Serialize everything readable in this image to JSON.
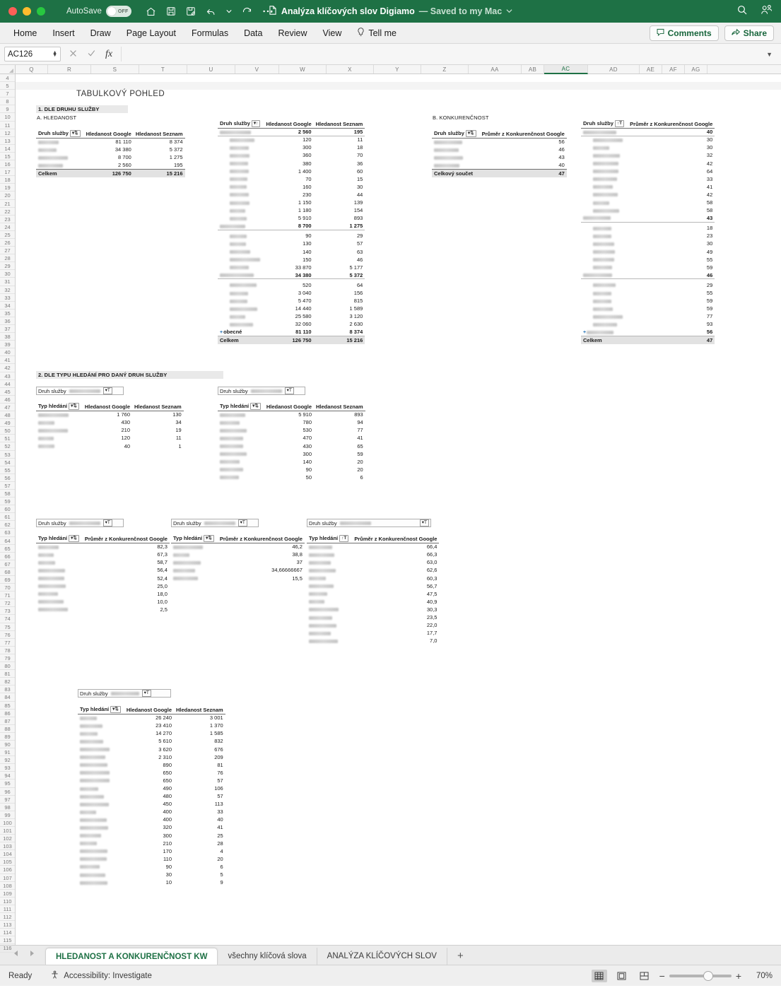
{
  "titlebar": {
    "autosave_label": "AutoSave",
    "autosave_state": "OFF",
    "document_title": "Analýza klíčových slov Digiamo",
    "saved_status": "— Saved to my Mac",
    "icons": [
      "home-icon",
      "save-icon",
      "save-as-icon",
      "undo-icon",
      "redo-icon",
      "more-icon",
      "search-icon",
      "collaborators-icon"
    ]
  },
  "ribbon": {
    "tabs": [
      {
        "label": "Home"
      },
      {
        "label": "Insert"
      },
      {
        "label": "Draw"
      },
      {
        "label": "Page Layout"
      },
      {
        "label": "Formulas"
      },
      {
        "label": "Data"
      },
      {
        "label": "Review"
      },
      {
        "label": "View"
      },
      {
        "label": "Tell me"
      }
    ],
    "comments_label": "Comments",
    "share_label": "Share"
  },
  "formula_bar": {
    "name_box": "AC126",
    "formula_value": "",
    "cancel_icon": "cancel-icon",
    "confirm_icon": "confirm-icon",
    "function_icon": "fx"
  },
  "grid": {
    "columns": [
      "Q",
      "R",
      "S",
      "T",
      "U",
      "V",
      "W",
      "X",
      "Y",
      "Z",
      "AA",
      "AB",
      "AC",
      "AD",
      "AE",
      "AF",
      "AG"
    ],
    "selected_column": "AC",
    "first_row": 4,
    "last_row": 116,
    "hidden_row_gap_after": 5
  },
  "sheet_content": {
    "page_title": "TABULKOVÝ POHLED",
    "section1_heading": "1. DLE DRUHU SLUŽBY",
    "section1a_heading": "A. HLEDANOST",
    "section1b_heading": "B. KONKURENČNOST",
    "section2_heading": "2. DLE TYPU HLEDÁNÍ PRO DANÝ DRUH SLUŽBY",
    "labels": {
      "druh_sluzby": "Druh služby",
      "typ_hledani": "Typ hledání",
      "hledanost_google": "Hledanost Google",
      "hledanost_seznam": "Hledanost Seznam",
      "prumer_konkurencnost": "Průměr z Konkurenčnost Google",
      "celkem": "Celkem",
      "celkovy_soucet": "Celkový součet",
      "obecne": "obecné"
    },
    "table_A_summary": {
      "headers": [
        "Druh služby",
        "Hledanost Google",
        "Hledanost Seznam"
      ],
      "rows": [
        {
          "label": "",
          "google": "81 110",
          "seznam": "8 374"
        },
        {
          "label": "",
          "google": "34 380",
          "seznam": "5 372"
        },
        {
          "label": "",
          "google": "8 700",
          "seznam": "1 275"
        },
        {
          "label": "",
          "google": "2 560",
          "seznam": "195"
        }
      ],
      "total": {
        "label": "Celkem",
        "google": "126 750",
        "seznam": "15 216"
      }
    },
    "table_A_detail": {
      "headers": [
        "Druh služby",
        "Hledanost Google",
        "Hledanost Seznam"
      ],
      "groups": [
        {
          "header": {
            "label": "",
            "google": "2 560",
            "seznam": "195"
          },
          "rows": [
            {
              "label": "",
              "google": "120",
              "seznam": "11"
            },
            {
              "label": "",
              "google": "300",
              "seznam": "18"
            },
            {
              "label": "",
              "google": "360",
              "seznam": "70"
            },
            {
              "label": "",
              "google": "380",
              "seznam": "36"
            },
            {
              "label": "",
              "google": "1 400",
              "seznam": "60"
            }
          ]
        },
        {
          "header": {
            "label": "",
            "google": "8 700",
            "seznam": "1 275"
          },
          "rows": [
            {
              "label": "",
              "google": "70",
              "seznam": "15"
            },
            {
              "label": "",
              "google": "160",
              "seznam": "30"
            },
            {
              "label": "",
              "google": "230",
              "seznam": "44"
            },
            {
              "label": "",
              "google": "1 150",
              "seznam": "139"
            },
            {
              "label": "",
              "google": "1 180",
              "seznam": "154"
            },
            {
              "label": "",
              "google": "5 910",
              "seznam": "893"
            }
          ]
        },
        {
          "header": {
            "label": "",
            "google": "34 380",
            "seznam": "5 372"
          },
          "rows": [
            {
              "label": "",
              "google": "90",
              "seznam": "29"
            },
            {
              "label": "",
              "google": "130",
              "seznam": "57"
            },
            {
              "label": "",
              "google": "140",
              "seznam": "63"
            },
            {
              "label": "",
              "google": "150",
              "seznam": "46"
            },
            {
              "label": "",
              "google": "33 870",
              "seznam": "5 177"
            }
          ]
        },
        {
          "header": {
            "label": "obecné",
            "google": "81 110",
            "seznam": "8 374",
            "expandable": true
          },
          "rows": [
            {
              "label": "",
              "google": "520",
              "seznam": "64"
            },
            {
              "label": "",
              "google": "3 040",
              "seznam": "156"
            },
            {
              "label": "",
              "google": "5 470",
              "seznam": "815"
            },
            {
              "label": "",
              "google": "14 440",
              "seznam": "1 589"
            },
            {
              "label": "",
              "google": "25 580",
              "seznam": "3 120"
            },
            {
              "label": "",
              "google": "32 060",
              "seznam": "2 630"
            }
          ]
        }
      ],
      "total": {
        "label": "Celkem",
        "google": "126 750",
        "seznam": "15 216"
      }
    },
    "table_B_summary": {
      "headers": [
        "Druh služby",
        "Průměr z Konkurenčnost Google"
      ],
      "rows": [
        {
          "label": "",
          "value": "56"
        },
        {
          "label": "",
          "value": "46"
        },
        {
          "label": "",
          "value": "43"
        },
        {
          "label": "",
          "value": "40"
        }
      ],
      "total": {
        "label": "Celkový součet",
        "value": "47"
      }
    },
    "table_B_detail": {
      "headers": [
        "Druh služby",
        "Průměr z Konkurenčnost Google"
      ],
      "groups": [
        {
          "header": {
            "label": "",
            "value": "40"
          },
          "rows": [
            {
              "label": "",
              "value": "30"
            },
            {
              "label": "",
              "value": "30"
            },
            {
              "label": "",
              "value": "32"
            },
            {
              "label": "",
              "value": "42"
            },
            {
              "label": "",
              "value": "64"
            }
          ]
        },
        {
          "header": {
            "label": "",
            "value": "43"
          },
          "rows": [
            {
              "label": "",
              "value": "33"
            },
            {
              "label": "",
              "value": "41"
            },
            {
              "label": "",
              "value": "42"
            },
            {
              "label": "",
              "value": "58"
            },
            {
              "label": "",
              "value": "58"
            }
          ]
        },
        {
          "header": {
            "label": "",
            "value": "46"
          },
          "rows": [
            {
              "label": "",
              "value": "18"
            },
            {
              "label": "",
              "value": "23"
            },
            {
              "label": "",
              "value": "30"
            },
            {
              "label": "",
              "value": "49"
            },
            {
              "label": "",
              "value": "55"
            },
            {
              "label": "",
              "value": "59"
            }
          ]
        },
        {
          "header": {
            "label": "",
            "value": "56",
            "expandable": true
          },
          "rows": [
            {
              "label": "",
              "value": "29"
            },
            {
              "label": "",
              "value": "55"
            },
            {
              "label": "",
              "value": "59"
            },
            {
              "label": "",
              "value": "59"
            },
            {
              "label": "",
              "value": "77"
            },
            {
              "label": "",
              "value": "93"
            }
          ]
        }
      ],
      "total": {
        "label": "Celkem",
        "value": "47"
      }
    },
    "section2_tables": [
      {
        "slicer_label": "Druh služby",
        "headers": [
          "Typ hledání",
          "Hledanost Google",
          "Hledanost Seznam"
        ],
        "rows": [
          {
            "label": "",
            "google": "1 760",
            "seznam": "130"
          },
          {
            "label": "",
            "google": "430",
            "seznam": "34"
          },
          {
            "label": "",
            "google": "210",
            "seznam": "19"
          },
          {
            "label": "",
            "google": "120",
            "seznam": "11"
          },
          {
            "label": "",
            "google": "40",
            "seznam": "1"
          }
        ]
      },
      {
        "slicer_label": "Druh služby",
        "headers": [
          "Typ hledání",
          "Hledanost Google",
          "Hledanost Seznam"
        ],
        "rows": [
          {
            "label": "",
            "google": "5 910",
            "seznam": "893"
          },
          {
            "label": "",
            "google": "780",
            "seznam": "94"
          },
          {
            "label": "",
            "google": "530",
            "seznam": "77"
          },
          {
            "label": "",
            "google": "470",
            "seznam": "41"
          },
          {
            "label": "",
            "google": "430",
            "seznam": "65"
          },
          {
            "label": "",
            "google": "300",
            "seznam": "59"
          },
          {
            "label": "",
            "google": "140",
            "seznam": "20"
          },
          {
            "label": "",
            "google": "90",
            "seznam": "20"
          },
          {
            "label": "",
            "google": "50",
            "seznam": "6"
          }
        ]
      }
    ],
    "section2_konkurence_tables": [
      {
        "slicer_label": "Druh služby",
        "headers": [
          "Typ hledání",
          "Průměr z Konkurenčnost Google"
        ],
        "rows": [
          {
            "label": "",
            "value": "82,3"
          },
          {
            "label": "",
            "value": "67,3"
          },
          {
            "label": "",
            "value": "58,7"
          },
          {
            "label": "",
            "value": "56,4"
          },
          {
            "label": "",
            "value": "52,4"
          },
          {
            "label": "",
            "value": "25,0"
          },
          {
            "label": "",
            "value": "18,0"
          },
          {
            "label": "",
            "value": "10,0"
          },
          {
            "label": "",
            "value": "2,5"
          }
        ]
      },
      {
        "slicer_label": "Druh služby",
        "headers": [
          "Typ hledání",
          "Průměr z Konkurenčnost Google"
        ],
        "rows": [
          {
            "label": "",
            "value": "46,2"
          },
          {
            "label": "",
            "value": "38,8"
          },
          {
            "label": "",
            "value": "37"
          },
          {
            "label": "",
            "value": "34,66666667"
          },
          {
            "label": "",
            "value": "15,5"
          }
        ]
      },
      {
        "slicer_label": "Druh služby",
        "headers": [
          "Typ hledání",
          "Průměr z Konkurenčnost Google"
        ],
        "rows": [
          {
            "label": "",
            "value": "66,4"
          },
          {
            "label": "",
            "value": "66,3"
          },
          {
            "label": "",
            "value": "63,0"
          },
          {
            "label": "",
            "value": "62,6"
          },
          {
            "label": "",
            "value": "60,3"
          },
          {
            "label": "",
            "value": "56,7"
          },
          {
            "label": "",
            "value": "47,5"
          },
          {
            "label": "",
            "value": "40,9"
          },
          {
            "label": "",
            "value": "30,3"
          },
          {
            "label": "",
            "value": "23,5"
          },
          {
            "label": "",
            "value": "22,0"
          },
          {
            "label": "",
            "value": "17,7"
          },
          {
            "label": "",
            "value": "7,0"
          }
        ]
      }
    ],
    "bottom_table": {
      "slicer_label": "Druh služby",
      "headers": [
        "Typ hledání",
        "Hledanost Google",
        "Hledanost Seznam"
      ],
      "rows": [
        {
          "label": "",
          "google": "26 240",
          "seznam": "3 001"
        },
        {
          "label": "",
          "google": "23 410",
          "seznam": "1 370"
        },
        {
          "label": "",
          "google": "14 270",
          "seznam": "1 585"
        },
        {
          "label": "",
          "google": "5 610",
          "seznam": "832"
        },
        {
          "label": "",
          "google": "3 620",
          "seznam": "676"
        },
        {
          "label": "",
          "google": "2 310",
          "seznam": "209"
        },
        {
          "label": "",
          "google": "890",
          "seznam": "81"
        },
        {
          "label": "",
          "google": "650",
          "seznam": "76"
        },
        {
          "label": "",
          "google": "650",
          "seznam": "57"
        },
        {
          "label": "",
          "google": "490",
          "seznam": "106"
        },
        {
          "label": "",
          "google": "480",
          "seznam": "57"
        },
        {
          "label": "",
          "google": "450",
          "seznam": "113"
        },
        {
          "label": "",
          "google": "400",
          "seznam": "33"
        },
        {
          "label": "",
          "google": "400",
          "seznam": "40"
        },
        {
          "label": "",
          "google": "320",
          "seznam": "41"
        },
        {
          "label": "",
          "google": "300",
          "seznam": "25"
        },
        {
          "label": "",
          "google": "210",
          "seznam": "28"
        },
        {
          "label": "",
          "google": "170",
          "seznam": "4"
        },
        {
          "label": "",
          "google": "110",
          "seznam": "20"
        },
        {
          "label": "",
          "google": "90",
          "seznam": "6"
        },
        {
          "label": "",
          "google": "30",
          "seznam": "5"
        },
        {
          "label": "",
          "google": "10",
          "seznam": "9"
        }
      ]
    }
  },
  "sheet_tabs": {
    "tabs": [
      {
        "label": "HLEDANOST A KONKURENČNOST KW",
        "active": true
      },
      {
        "label": "všechny klíčová slova",
        "active": false
      },
      {
        "label": "ANALÝZA KLÍČOVÝCH SLOV",
        "active": false
      }
    ],
    "add_label": "+"
  },
  "status_bar": {
    "ready_label": "Ready",
    "accessibility_label": "Accessibility: Investigate",
    "zoom_value": "70%",
    "view_buttons": [
      "normal-view-icon",
      "page-layout-icon",
      "page-break-icon"
    ]
  },
  "colors": {
    "brand_green": "#1e7145",
    "accent_green": "#18663c",
    "selected_col": "#1e7145"
  }
}
